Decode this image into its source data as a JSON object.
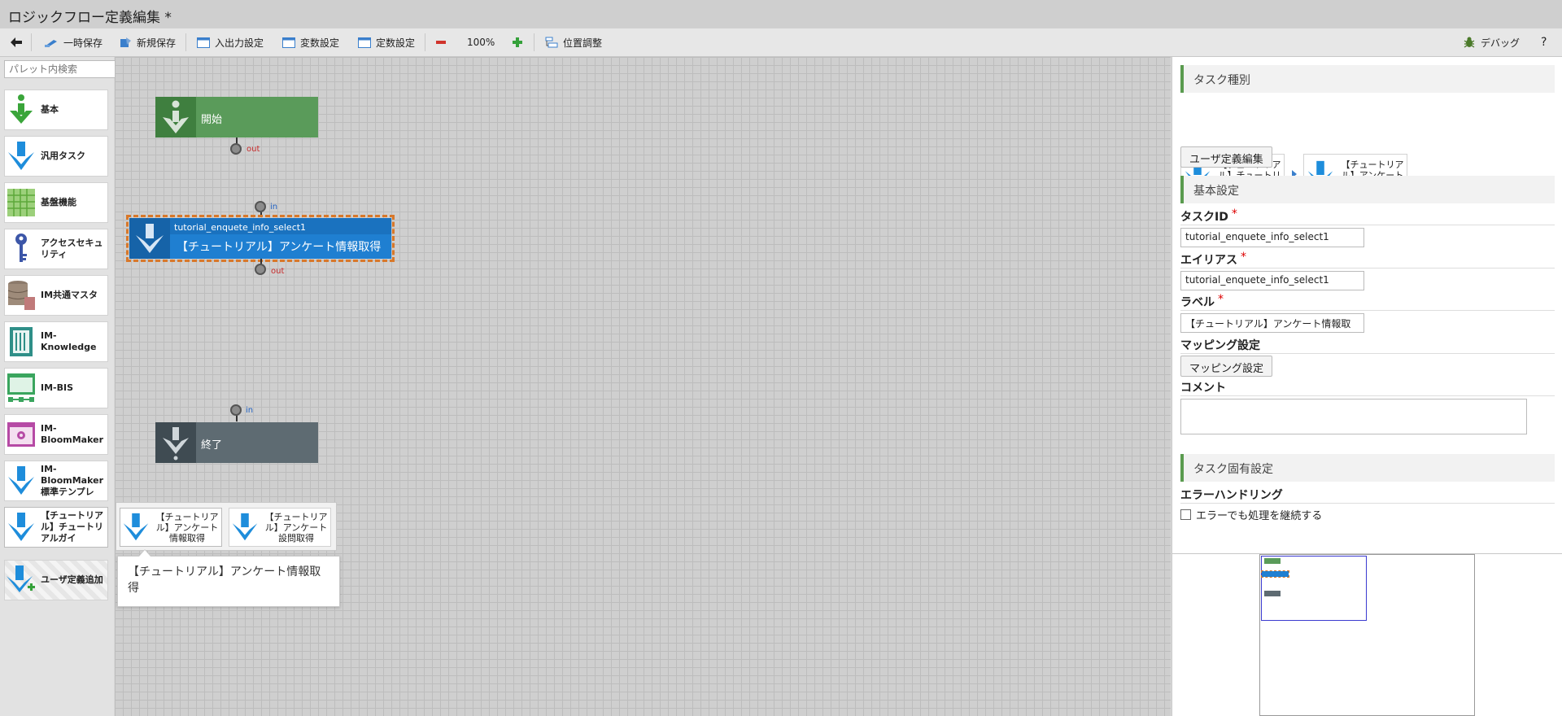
{
  "window": {
    "title": "ロジックフロー定義編集 *"
  },
  "toolbar": {
    "back_label": "",
    "temp_save": "一時保存",
    "new_save": "新規保存",
    "io_settings": "入出力設定",
    "var_settings": "変数設定",
    "const_settings": "定数設定",
    "zoom": "100%",
    "position_adjust": "位置調整",
    "debug": "デバッグ",
    "help": "?"
  },
  "palette": {
    "search_placeholder": "パレット内検索",
    "items": [
      {
        "label": "基本",
        "icon": "green-arrow-icon"
      },
      {
        "label": "汎用タスク",
        "icon": "blue-arrow-icon"
      },
      {
        "label": "基盤機能",
        "icon": "grid-icon"
      },
      {
        "label": "アクセスセキュリティ",
        "icon": "key-icon"
      },
      {
        "label": "IM共通マスタ",
        "icon": "database-icon"
      },
      {
        "label": "IM-Knowledge",
        "icon": "book-icon"
      },
      {
        "label": "IM-BIS",
        "icon": "bis-icon"
      },
      {
        "label": "IM-BloomMaker",
        "icon": "bloommaker-icon"
      },
      {
        "label": "IM-BloomMaker標準テンプレ",
        "icon": "blue-arrow-icon"
      },
      {
        "label": "【チュートリアル】チュートリアルガイ",
        "icon": "blue-arrow-icon"
      },
      {
        "label": "ユーザ定義追加",
        "icon": "add-arrow-icon"
      }
    ],
    "flyout": [
      {
        "label": "【チュートリアル】アンケート情報取得"
      },
      {
        "label": "【チュートリアル】アンケート設問取得"
      }
    ],
    "tooltip": "【チュートリアル】アンケート情報取得"
  },
  "canvas": {
    "start": {
      "label": "開始",
      "out": "out"
    },
    "task": {
      "id": "tutorial_enquete_info_select1",
      "label": "【チュートリアル】アンケート情報取得",
      "in": "in",
      "out": "out"
    },
    "end": {
      "label": "終了",
      "in": "in"
    }
  },
  "panel": {
    "task_type_title": "タスク種別",
    "task_type_parent": "【チュートリアル】チュートリアルガイ",
    "task_type_child": "【チュートリアル】アンケート情報取得",
    "user_def_edit": "ユーザ定義編集",
    "basic_title": "基本設定",
    "task_id_label": "タスクID",
    "task_id_value": "tutorial_enquete_info_select1",
    "alias_label": "エイリアス",
    "alias_value": "tutorial_enquete_info_select1",
    "label_label": "ラベル",
    "label_value": "【チュートリアル】アンケート情報取",
    "mapping_label": "マッピング設定",
    "mapping_button": "マッピング設定",
    "comment_label": "コメント",
    "comment_value": "",
    "required_mark": "*",
    "specific_title": "タスク固有設定",
    "error_handling_label": "エラーハンドリング",
    "error_continue": "エラーでも処理を継続する"
  },
  "colors": {
    "start_green": "#5a9b5a",
    "task_blue": "#1f7fd1",
    "end_gray": "#5e6b72",
    "selection": "#d8782a"
  }
}
